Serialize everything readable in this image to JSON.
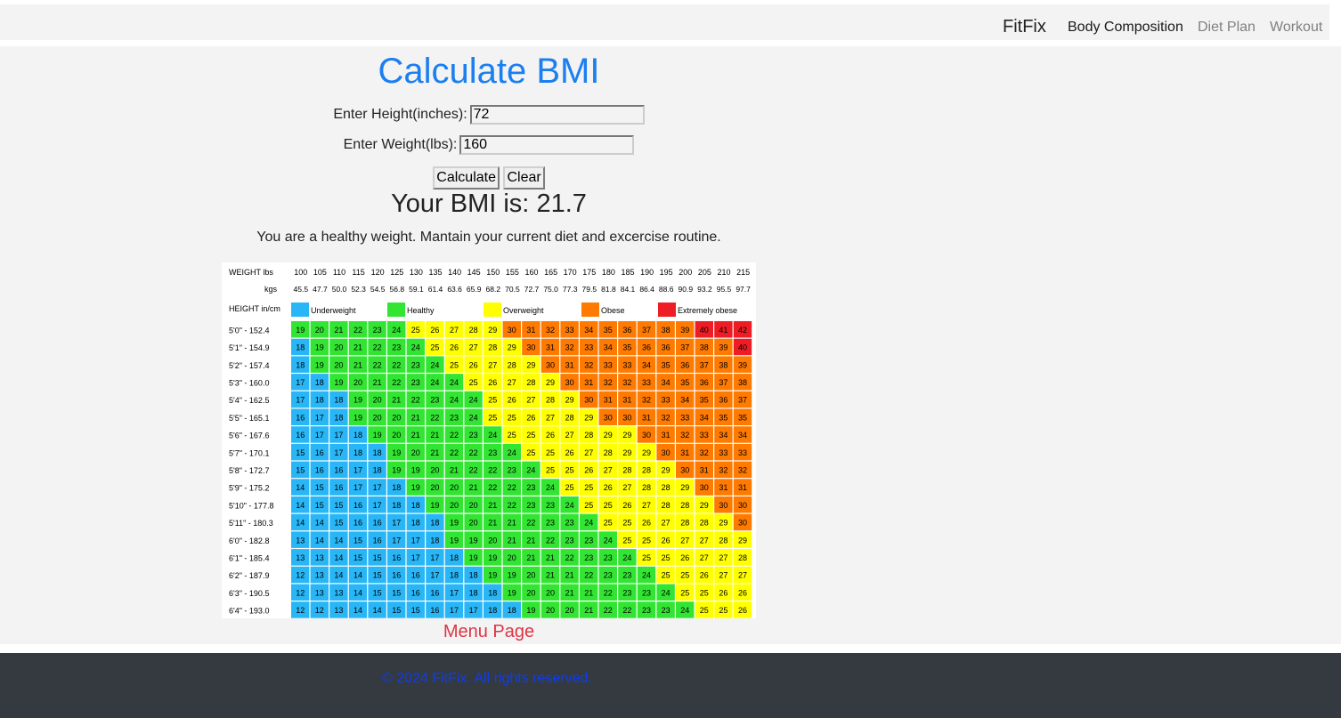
{
  "navbar": {
    "brand": "FitFix",
    "links": [
      "Body Composition",
      "Diet Plan",
      "Workout"
    ]
  },
  "main": {
    "title": "Calculate BMI",
    "height_label": "Enter Height(inches):",
    "height_value": "72",
    "weight_label": "Enter Weight(lbs):",
    "weight_value": "160",
    "calculate_label": "Calculate",
    "clear_label": "Clear",
    "result_label": "Your BMI is:",
    "result_value": "21.7",
    "advice": "You are a healthy weight. Mantain your current diet and excercise routine.",
    "menu_link": "Menu Page"
  },
  "chart": {
    "weight_header": "WEIGHT lbs",
    "kgs_header": "kgs",
    "height_header": "HEIGHT in/cm",
    "weights_lbs": [
      "100",
      "105",
      "110",
      "115",
      "120",
      "125",
      "130",
      "135",
      "140",
      "145",
      "150",
      "155",
      "160",
      "165",
      "170",
      "175",
      "180",
      "185",
      "190",
      "195",
      "200",
      "205",
      "210",
      "215"
    ],
    "weights_kg": [
      "45.5",
      "47.7",
      "50.0",
      "52.3",
      "54.5",
      "56.8",
      "59.1",
      "61.4",
      "63.6",
      "65.9",
      "68.2",
      "70.5",
      "72.7",
      "75.0",
      "77.3",
      "79.5",
      "81.8",
      "84.1",
      "86.4",
      "88.6",
      "90.9",
      "93.2",
      "95.5",
      "97.7"
    ],
    "legend": [
      {
        "label": "Underweight",
        "color": "#29b6f6"
      },
      {
        "label": "Healthy",
        "color": "#33e533"
      },
      {
        "label": "Overweight",
        "color": "#ffff00"
      },
      {
        "label": "Obese",
        "color": "#ff7a00"
      },
      {
        "label": "Extremely obese",
        "color": "#ee1c25"
      }
    ],
    "heights": [
      "5'0\" - 152.4",
      "5'1\" - 154.9",
      "5'2\" - 157.4",
      "5'3\" - 160.0",
      "5'4\" - 162.5",
      "5'5\" - 165.1",
      "5'6\" - 167.6",
      "5'7\" - 170.1",
      "5'8\" - 172.7",
      "5'9\" - 175.2",
      "5'10\" - 177.8",
      "5'11\" - 180.3",
      "6'0\" - 182.8",
      "6'1\" - 185.4",
      "6'2\" - 187.9",
      "6'3\" - 190.5",
      "6'4\" - 193.0"
    ],
    "rows": [
      [
        19,
        20,
        21,
        22,
        23,
        24,
        25,
        26,
        27,
        28,
        29,
        30,
        31,
        32,
        33,
        34,
        35,
        36,
        37,
        38,
        39,
        40,
        41,
        42
      ],
      [
        18,
        19,
        20,
        21,
        22,
        23,
        24,
        25,
        26,
        27,
        28,
        29,
        30,
        31,
        32,
        33,
        34,
        35,
        36,
        36,
        37,
        38,
        39,
        40
      ],
      [
        18,
        19,
        20,
        21,
        22,
        22,
        23,
        24,
        25,
        26,
        27,
        28,
        29,
        30,
        31,
        32,
        33,
        33,
        34,
        35,
        36,
        37,
        38,
        39
      ],
      [
        17,
        18,
        19,
        20,
        21,
        22,
        23,
        24,
        24,
        25,
        26,
        27,
        28,
        29,
        30,
        31,
        32,
        32,
        33,
        34,
        35,
        36,
        37,
        38
      ],
      [
        17,
        18,
        18,
        19,
        20,
        21,
        22,
        23,
        24,
        24,
        25,
        26,
        27,
        28,
        29,
        30,
        31,
        31,
        32,
        33,
        34,
        35,
        36,
        37
      ],
      [
        16,
        17,
        18,
        19,
        20,
        20,
        21,
        22,
        23,
        24,
        25,
        25,
        26,
        27,
        28,
        29,
        30,
        30,
        31,
        32,
        33,
        34,
        35,
        35
      ],
      [
        16,
        17,
        17,
        18,
        19,
        20,
        21,
        21,
        22,
        23,
        24,
        25,
        25,
        26,
        27,
        28,
        29,
        29,
        30,
        31,
        32,
        33,
        34,
        34
      ],
      [
        15,
        16,
        17,
        18,
        18,
        19,
        20,
        21,
        22,
        22,
        23,
        24,
        25,
        25,
        26,
        27,
        28,
        29,
        29,
        30,
        31,
        32,
        33,
        33
      ],
      [
        15,
        16,
        16,
        17,
        18,
        19,
        19,
        20,
        21,
        22,
        22,
        23,
        24,
        25,
        25,
        26,
        27,
        28,
        28,
        29,
        30,
        31,
        32,
        32
      ],
      [
        14,
        15,
        16,
        17,
        17,
        18,
        19,
        20,
        20,
        21,
        22,
        22,
        23,
        24,
        25,
        25,
        26,
        27,
        28,
        28,
        29,
        30,
        31,
        31
      ],
      [
        14,
        15,
        15,
        16,
        17,
        18,
        18,
        19,
        20,
        20,
        21,
        22,
        23,
        23,
        24,
        25,
        25,
        26,
        27,
        28,
        28,
        29,
        30,
        30
      ],
      [
        14,
        14,
        15,
        16,
        16,
        17,
        18,
        18,
        19,
        20,
        21,
        21,
        22,
        23,
        23,
        24,
        25,
        25,
        26,
        27,
        28,
        28,
        29,
        30
      ],
      [
        13,
        14,
        14,
        15,
        16,
        17,
        17,
        18,
        19,
        19,
        20,
        21,
        21,
        22,
        23,
        23,
        24,
        25,
        25,
        26,
        27,
        27,
        28,
        29
      ],
      [
        13,
        13,
        14,
        15,
        15,
        16,
        17,
        17,
        18,
        19,
        19,
        20,
        21,
        21,
        22,
        23,
        23,
        24,
        25,
        25,
        26,
        27,
        27,
        28
      ],
      [
        12,
        13,
        14,
        14,
        15,
        16,
        16,
        17,
        18,
        18,
        19,
        19,
        20,
        21,
        21,
        22,
        23,
        23,
        24,
        25,
        25,
        26,
        27,
        27
      ],
      [
        12,
        13,
        13,
        14,
        15,
        15,
        16,
        16,
        17,
        18,
        18,
        19,
        20,
        20,
        21,
        21,
        22,
        23,
        23,
        24,
        25,
        25,
        26,
        26
      ],
      [
        12,
        12,
        13,
        14,
        14,
        15,
        15,
        16,
        17,
        17,
        18,
        18,
        19,
        20,
        20,
        21,
        22,
        22,
        23,
        23,
        24,
        25,
        25,
        26
      ]
    ]
  },
  "footer": {
    "text": "© 2024 FitFix. All rights reserved."
  }
}
